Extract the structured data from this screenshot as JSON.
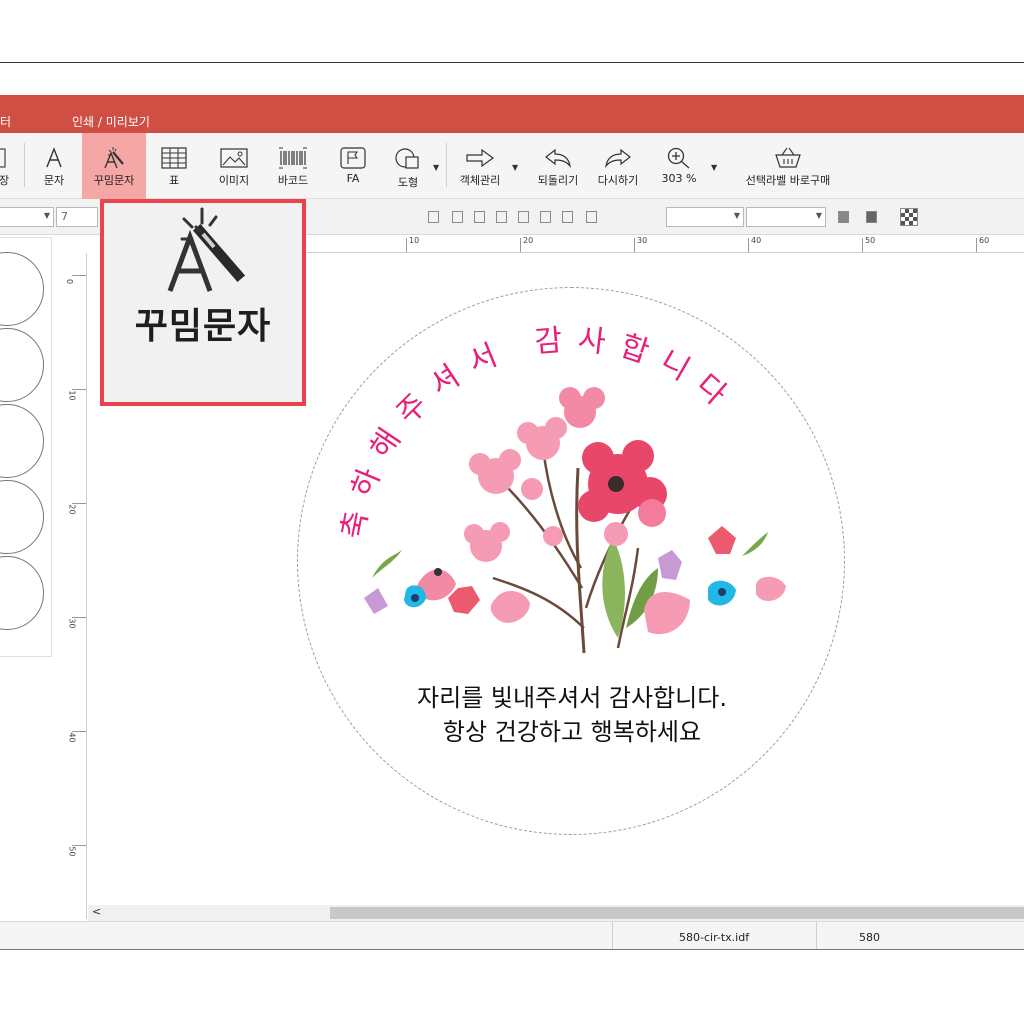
{
  "menu": {
    "left_fragment": "터",
    "print_preview": "인쇄 / 미리보기"
  },
  "toolbar": {
    "partial_left": "장",
    "text": "문자",
    "deco_text": "꾸밈문자",
    "table": "표",
    "image": "이미지",
    "barcode": "바코드",
    "fa": "FA",
    "shape": "도형",
    "object_manage": "객체관리",
    "undo": "되돌리기",
    "redo": "다시하기",
    "zoom": "303 %",
    "buy_label": "선택라벨 바로구매"
  },
  "formatbar": {
    "font_size": "7"
  },
  "ruler": {
    "top_ticks": [
      "10",
      "20",
      "30",
      "40",
      "50",
      "60"
    ],
    "left_ticks": [
      "0",
      "10",
      "20",
      "30",
      "40",
      "50"
    ]
  },
  "callout": {
    "label": "꾸밈문자"
  },
  "sticker": {
    "arc_text": "축하해주셔서 감사합니다",
    "line1": "자리를 빛내주셔서 감사합니다.",
    "line2": "항상 건강하고 행복하세요",
    "arc_color": "#e8207a"
  },
  "status": {
    "file": "580-cir-tx.idf",
    "label_no": "580"
  }
}
